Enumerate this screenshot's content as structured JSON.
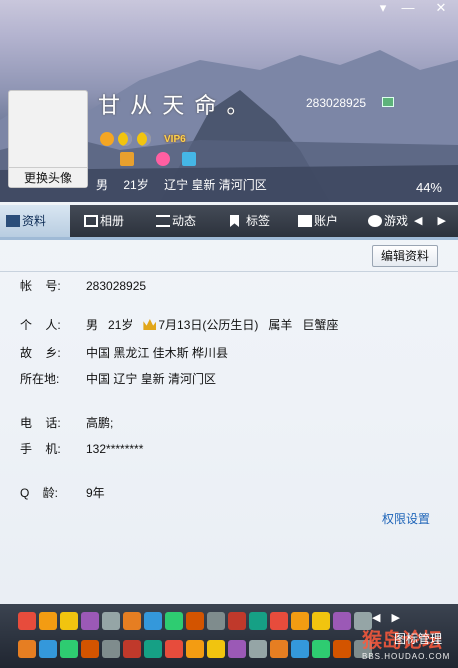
{
  "window": {
    "controls": [
      "▾",
      "—",
      "✕"
    ]
  },
  "profile": {
    "nickname": "甘 从 天 命 。",
    "qq_number": "283028925",
    "change_avatar_label": "更换头像",
    "vip_label": "VIP6",
    "gender": "男",
    "age": "21岁",
    "location": "辽宁 皇新 清河门区",
    "completion": "44%"
  },
  "tabs": [
    {
      "label": "资料",
      "icon": "profile-card-icon"
    },
    {
      "label": "相册",
      "icon": "photo-album-icon"
    },
    {
      "label": "动态",
      "icon": "feed-list-icon"
    },
    {
      "label": "标签",
      "icon": "tag-bookmark-icon"
    },
    {
      "label": "账户",
      "icon": "wallet-icon"
    },
    {
      "label": "游戏",
      "icon": "game-icon"
    }
  ],
  "tab_arrows": "◀ ▶",
  "actions": {
    "edit_profile": "编辑资料",
    "permission_settings": "权限设置",
    "icon_management": "图标管理"
  },
  "details": {
    "account": {
      "label": "帐    号:",
      "value": "283028925"
    },
    "personal": {
      "label": "个    人:",
      "gender": "男",
      "age": "21岁",
      "birthday": "7月13日(公历生日)",
      "zodiac": "属羊",
      "constellation": "巨蟹座"
    },
    "hometown": {
      "label": "故    乡:",
      "value": "中国 黑龙江 佳木斯 桦川县"
    },
    "residence": {
      "label": "所在地:",
      "value": "中国 辽宁 皇新 清河门区"
    },
    "phone": {
      "label": "电    话:",
      "value": "高鹏;"
    },
    "mobile": {
      "label": "手    机:",
      "value": "132********"
    },
    "q_age": {
      "label": "Q    龄:",
      "value": "9年"
    }
  },
  "watermark": {
    "text": "猴岛论坛",
    "sub": "BBS.HOUDAO.COM"
  },
  "colors": {
    "accent": "#1d64b8",
    "tab_bar": "#2c323c",
    "active_tab": "#c9d9ea"
  }
}
